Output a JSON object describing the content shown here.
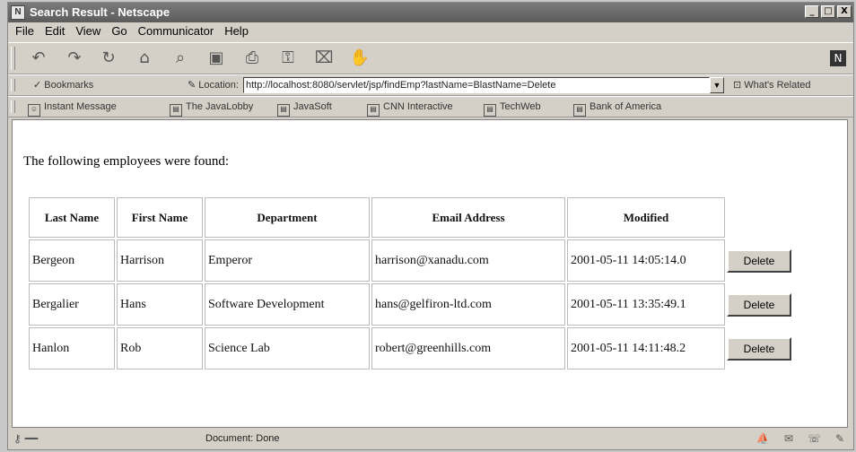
{
  "window": {
    "title": "Search Result - Netscape",
    "controls": [
      "_",
      "□",
      "X"
    ]
  },
  "menu": [
    "File",
    "Edit",
    "View",
    "Go",
    "Communicator",
    "Help"
  ],
  "location_bar": {
    "bookmarks_label": "Bookmarks",
    "location_label": "Location:",
    "url": "http://localhost:8080/servlet/jsp/findEmp?lastName=BlastName=Delete",
    "related_label": "What's Related"
  },
  "personal_toolbar": [
    "Instant Message",
    "The JavaLobby",
    "JavaSoft",
    "CNN Interactive",
    "TechWeb",
    "Bank of America"
  ],
  "page": {
    "found_text": "The following employees were found:",
    "table": {
      "headers": [
        "Last Name",
        "First Name",
        "Department",
        "Email Address",
        "Modified"
      ],
      "rows": [
        {
          "last": "Bergeon",
          "first": "Harrison",
          "dept": "Emperor",
          "email": "harrison@xanadu.com",
          "modified": "2001-05-11 14:05:14.0",
          "button": "Delete"
        },
        {
          "last": "Bergalier",
          "first": "Hans",
          "dept": "Software Development",
          "email": "hans@gelfiron-ltd.com",
          "modified": "2001-05-11 13:35:49.1",
          "button": "Delete"
        },
        {
          "last": "Hanlon",
          "first": "Rob",
          "dept": "Science Lab",
          "email": "robert@greenhills.com",
          "modified": "2001-05-11 14:11:48.2",
          "button": "Delete"
        }
      ]
    }
  },
  "status": {
    "text": "Document: Done"
  }
}
